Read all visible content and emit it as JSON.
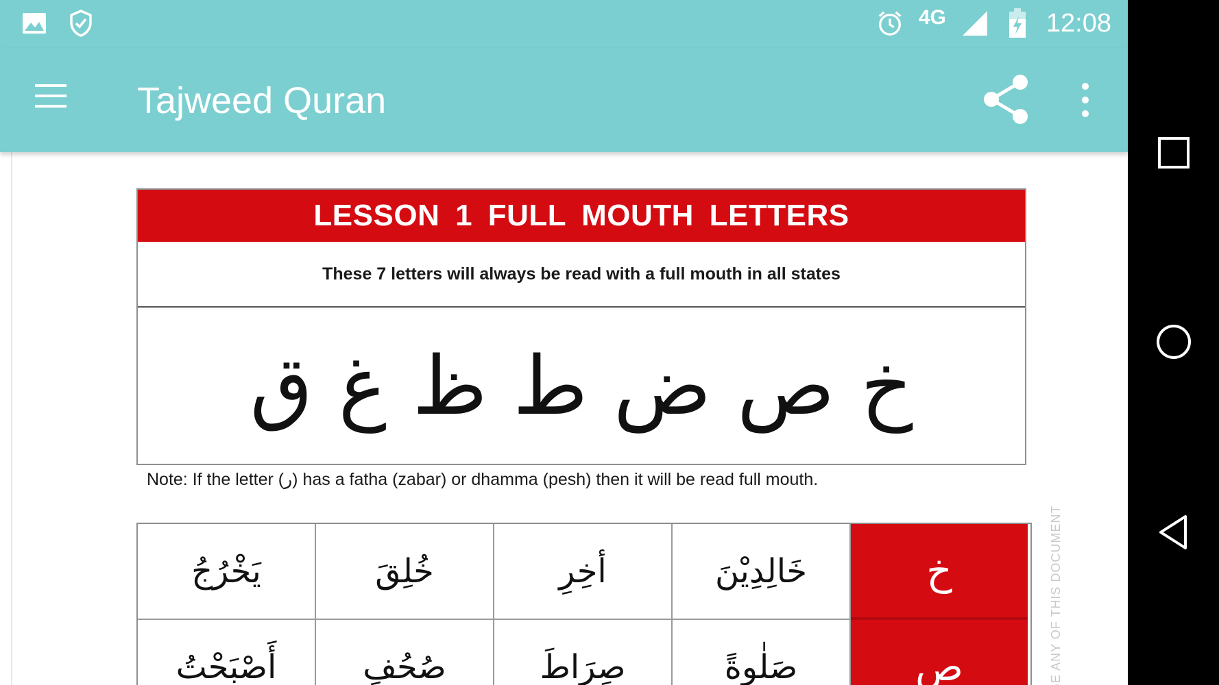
{
  "status_bar": {
    "left_icons": [
      "image-icon",
      "shield-check-icon"
    ],
    "right_icons": [
      "alarm-icon",
      "signal-icon",
      "battery-charging-icon"
    ],
    "network": "4G",
    "time": "12:08"
  },
  "app_bar": {
    "title": "Tajweed Quran",
    "icons": [
      "menu-icon",
      "share-icon",
      "more-vert-icon"
    ],
    "background": "#7ccfd0"
  },
  "lesson": {
    "header": "LESSON 1   FULL MOUTH LETTERS",
    "subtitle": "These 7 letters will always be read with a full mouth in all states",
    "letters": "خ ص ض ط ظ غ ق",
    "note": "Note: If the letter (ر) has a fatha (zabar) or dhamma (pesh) then it will be read full mouth.",
    "header_color": "#d50b12"
  },
  "examples": {
    "rows": [
      {
        "letter": "خ",
        "words": [
          "يَخْرُجُ",
          "خُلِقَ",
          "أخِرِ",
          "خَالِدِيْنَ"
        ]
      },
      {
        "letter": "ص",
        "words": [
          "أَصْبَحْتُ",
          "صُحُفٍ",
          "صِرَاطَ",
          "صَلٰوةً"
        ]
      }
    ]
  },
  "watermark": "GE ANY OF THIS DOCUMENT",
  "nav_bar": {
    "icons": [
      "recents-icon",
      "home-icon",
      "back-icon"
    ]
  }
}
